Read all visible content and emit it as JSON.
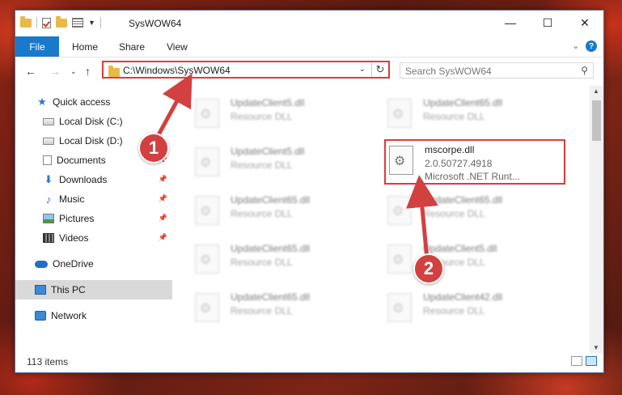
{
  "window": {
    "title": "SysWOW64"
  },
  "ribbon": {
    "tabs": [
      "File",
      "Home",
      "Share",
      "View"
    ]
  },
  "navigation": {
    "address": "C:\\Windows\\SysWOW64",
    "search_placeholder": "Search SysWOW64"
  },
  "sidebar": {
    "items": [
      {
        "label": "Quick access",
        "icon": "quick-access-star-icon"
      },
      {
        "label": "Local Disk (C:)",
        "icon": "drive-icon"
      },
      {
        "label": "Local Disk (D:)",
        "icon": "drive-icon"
      },
      {
        "label": "Documents",
        "icon": "documents-icon",
        "pinned": true
      },
      {
        "label": "Downloads",
        "icon": "downloads-icon",
        "pinned": true
      },
      {
        "label": "Music",
        "icon": "music-icon",
        "pinned": true
      },
      {
        "label": "Pictures",
        "icon": "pictures-icon",
        "pinned": true
      },
      {
        "label": "Videos",
        "icon": "videos-icon",
        "pinned": true
      },
      {
        "label": "OneDrive",
        "icon": "onedrive-icon"
      },
      {
        "label": "This PC",
        "icon": "this-pc-icon",
        "selected": true
      },
      {
        "label": "Network",
        "icon": "network-icon"
      }
    ]
  },
  "files": [
    {
      "name": "UpdateClient5.dll",
      "line2": "Resource DLL",
      "blurred": true
    },
    {
      "name": "UpdateClient65.dll",
      "line2": "Resource DLL",
      "blurred": true
    },
    {
      "name": "UpdateClient5.dll",
      "line2": "Resource DLL",
      "blurred": true
    },
    {
      "name": "mscorpe.dll",
      "line2": "2.0.50727.4918",
      "line3": "Microsoft .NET Runt...",
      "highlighted": true
    },
    {
      "name": "UpdateClient65.dll",
      "line2": "Resource DLL",
      "blurred": true
    },
    {
      "name": "UpdateClient65.dll",
      "line2": "Resource DLL",
      "blurred": true
    },
    {
      "name": "UpdateClient65.dll",
      "line2": "Resource DLL",
      "blurred": true
    },
    {
      "name": "UpdateClient5.dll",
      "line2": "Resource DLL",
      "blurred": true
    },
    {
      "name": "UpdateClient65.dll",
      "line2": "Resource DLL",
      "blurred": true
    },
    {
      "name": "UpdateClient42.dll",
      "line2": "Resource DLL",
      "blurred": true
    }
  ],
  "status": {
    "item_count": "113 items"
  },
  "annotations": {
    "badge1": "1",
    "badge2": "2",
    "color": "#d34040"
  }
}
